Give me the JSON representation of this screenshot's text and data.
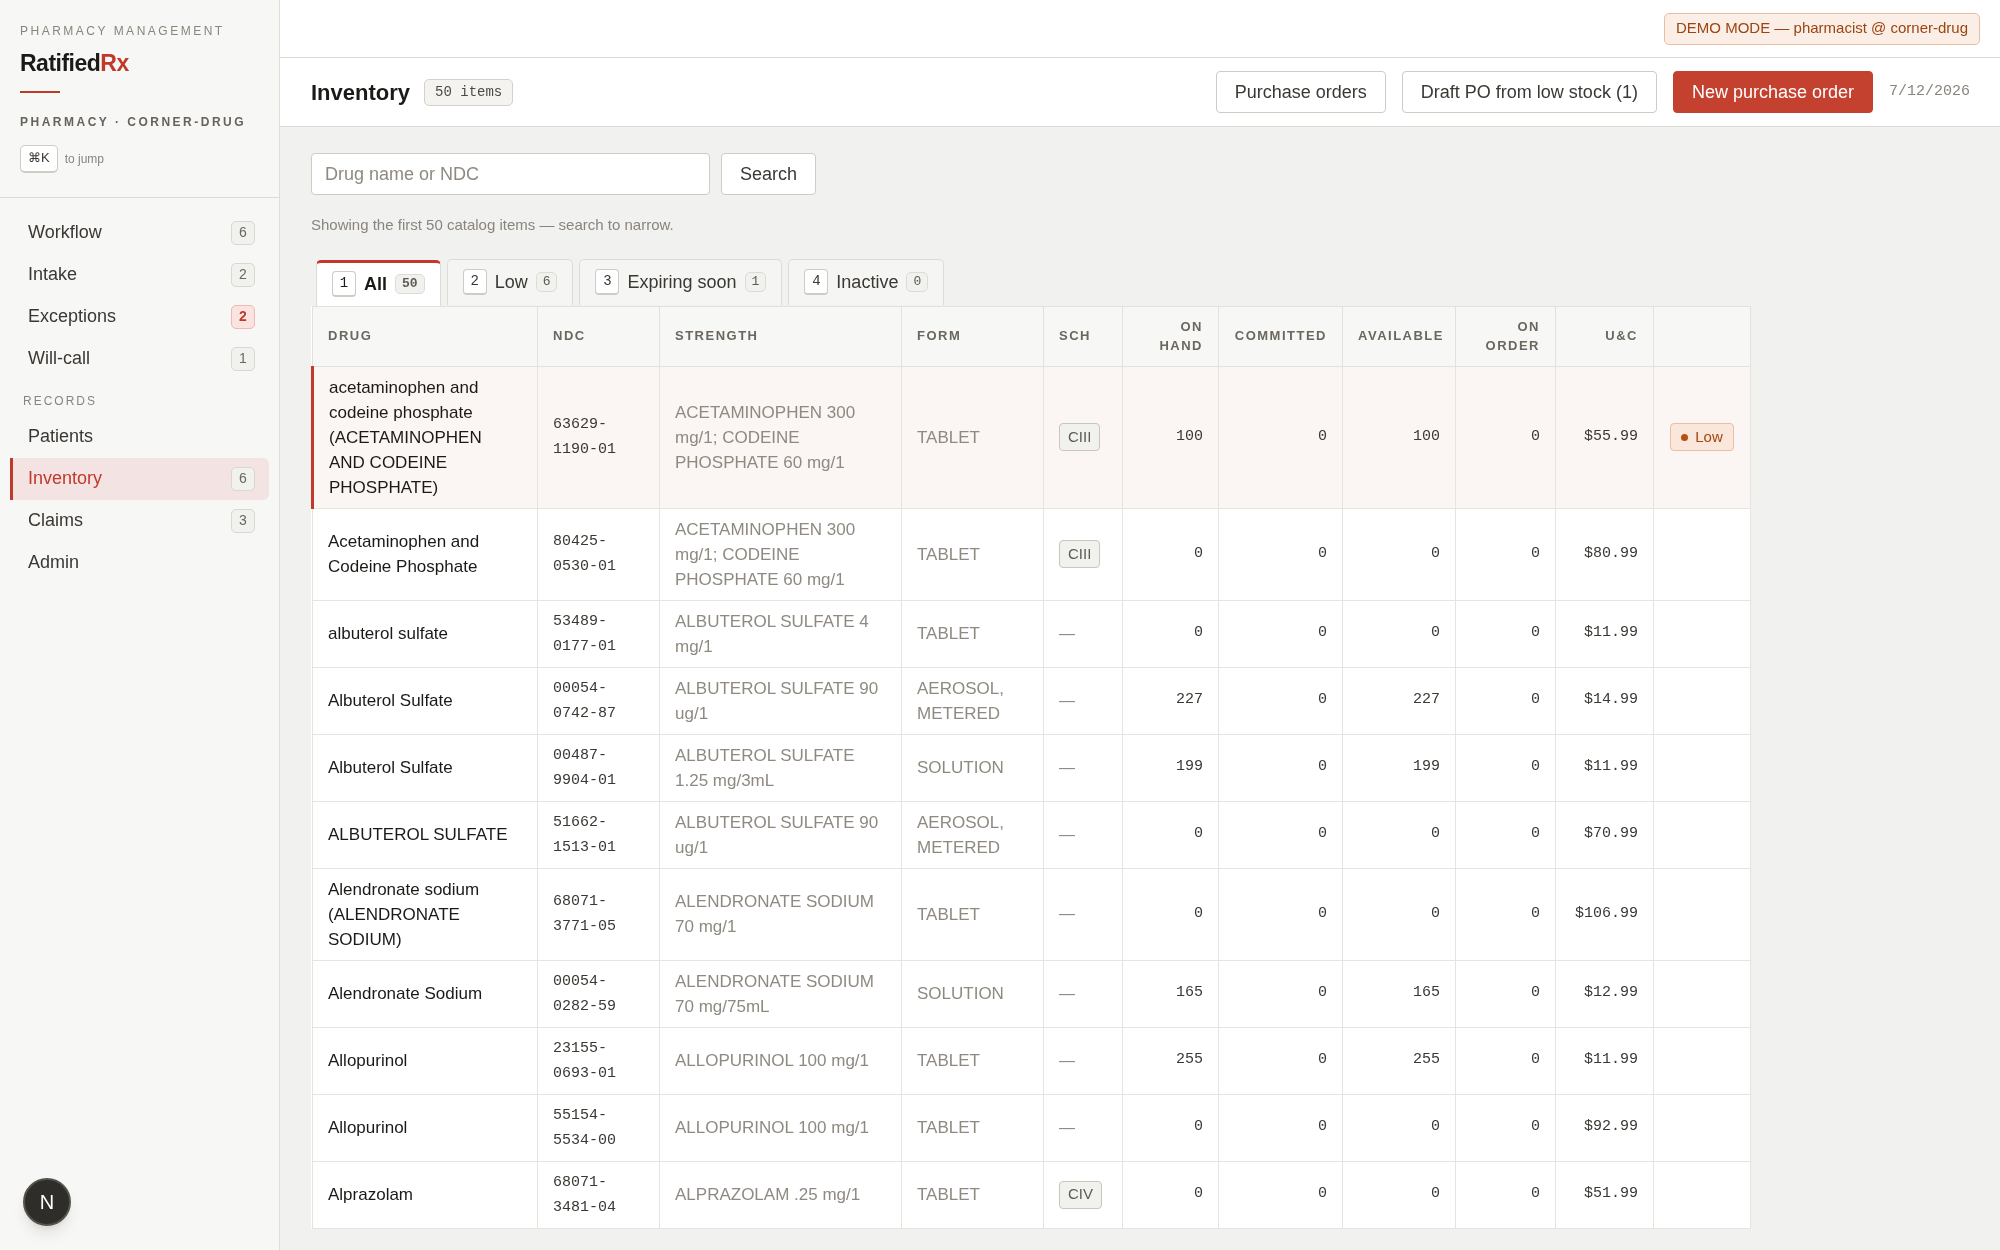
{
  "sidebar": {
    "eyebrow": "PHARMACY MANAGEMENT",
    "logo": {
      "name": "Ratified",
      "accent": "Rx"
    },
    "pharmacy": "PHARMACY · CORNER-DRUG",
    "shortcut": {
      "key": "⌘K",
      "hint": "to jump"
    },
    "items": [
      {
        "label": "Workflow",
        "count": "6",
        "alert": false,
        "selected": false
      },
      {
        "label": "Intake",
        "count": "2",
        "alert": false,
        "selected": false
      },
      {
        "label": "Exceptions",
        "count": "2",
        "alert": true,
        "selected": false
      },
      {
        "label": "Will-call",
        "count": "1",
        "alert": false,
        "selected": false
      }
    ],
    "section_label": "RECORDS",
    "records": [
      {
        "label": "Patients",
        "selected": false
      },
      {
        "label": "Inventory",
        "count": "6",
        "alert": false,
        "selected": true
      },
      {
        "label": "Claims",
        "count": "3",
        "alert": false,
        "selected": false
      },
      {
        "label": "Admin",
        "selected": false
      }
    ]
  },
  "user_avatar": "N",
  "demo_banner": "DEMO MODE — pharmacist @ corner-drug",
  "page": {
    "title": "Inventory",
    "count": "50 items",
    "buttons": [
      {
        "label": "Purchase orders",
        "kind": "secondary"
      },
      {
        "label": "Draft PO from low stock (1)",
        "kind": "secondary"
      },
      {
        "label": "New purchase order",
        "kind": "primary"
      }
    ],
    "date": "7/12/2026"
  },
  "search": {
    "placeholder": "Drug name or NDC",
    "button": "Search"
  },
  "hint": "Showing the first 50 catalog items — search to narrow.",
  "tabs": [
    {
      "key": "1",
      "label": "All",
      "count": "50",
      "selected": true
    },
    {
      "key": "2",
      "label": "Low",
      "count": "6",
      "selected": false
    },
    {
      "key": "3",
      "label": "Expiring soon",
      "count": "1",
      "selected": false
    },
    {
      "key": "4",
      "label": "Inactive",
      "count": "0",
      "selected": false
    }
  ],
  "table": {
    "columns": [
      "DRUG",
      "NDC",
      "STRENGTH",
      "FORM",
      "SCH",
      "ON HAND",
      "COMMITTED",
      "AVAILABLE",
      "ON ORDER",
      "U&C"
    ],
    "rows": [
      {
        "drug": "acetaminophen and codeine phosphate (ACETAMINOPHEN AND CODEINE PHOSPHATE)",
        "ndc": "63629-1190-01",
        "strength": "ACETAMINOPHEN 300 mg/1; CODEINE PHOSPHATE 60 mg/1",
        "form": "TABLET",
        "sch": "CIII",
        "controlled": true,
        "on_hand": "100",
        "committed": "0",
        "available": "100",
        "on_order": "0",
        "price": "$55.99",
        "flagged": true,
        "status": "Low"
      },
      {
        "drug": "Acetaminophen and Codeine Phosphate",
        "ndc": "80425-0530-01",
        "strength": "ACETAMINOPHEN 300 mg/1; CODEINE PHOSPHATE 60 mg/1",
        "form": "TABLET",
        "sch": "CIII",
        "controlled": true,
        "on_hand": "0",
        "committed": "0",
        "available": "0",
        "on_order": "0",
        "price": "$80.99",
        "flagged": false
      },
      {
        "drug": "albuterol sulfate",
        "ndc": "53489-0177-01",
        "strength": "ALBUTEROL SULFATE 4 mg/1",
        "form": "TABLET",
        "sch": "—",
        "controlled": false,
        "on_hand": "0",
        "committed": "0",
        "available": "0",
        "on_order": "0",
        "price": "$11.99",
        "flagged": false
      },
      {
        "drug": "Albuterol Sulfate",
        "ndc": "00054-0742-87",
        "strength": "ALBUTEROL SULFATE 90 ug/1",
        "form": "AEROSOL, METERED",
        "sch": "—",
        "controlled": false,
        "on_hand": "227",
        "committed": "0",
        "available": "227",
        "on_order": "0",
        "price": "$14.99",
        "flagged": false
      },
      {
        "drug": "Albuterol Sulfate",
        "ndc": "00487-9904-01",
        "strength": "ALBUTEROL SULFATE 1.25 mg/3mL",
        "form": "SOLUTION",
        "sch": "—",
        "controlled": false,
        "on_hand": "199",
        "committed": "0",
        "available": "199",
        "on_order": "0",
        "price": "$11.99",
        "flagged": false
      },
      {
        "drug": "ALBUTEROL SULFATE",
        "ndc": "51662-1513-01",
        "strength": "ALBUTEROL SULFATE 90 ug/1",
        "form": "AEROSOL, METERED",
        "sch": "—",
        "controlled": false,
        "on_hand": "0",
        "committed": "0",
        "available": "0",
        "on_order": "0",
        "price": "$70.99",
        "flagged": false
      },
      {
        "drug": "Alendronate sodium (ALENDRONATE SODIUM)",
        "ndc": "68071-3771-05",
        "strength": "ALENDRONATE SODIUM 70 mg/1",
        "form": "TABLET",
        "sch": "—",
        "controlled": false,
        "on_hand": "0",
        "committed": "0",
        "available": "0",
        "on_order": "0",
        "price": "$106.99",
        "flagged": false
      },
      {
        "drug": "Alendronate Sodium",
        "ndc": "00054-0282-59",
        "strength": "ALENDRONATE SODIUM 70 mg/75mL",
        "form": "SOLUTION",
        "sch": "—",
        "controlled": false,
        "on_hand": "165",
        "committed": "0",
        "available": "165",
        "on_order": "0",
        "price": "$12.99",
        "flagged": false
      },
      {
        "drug": "Allopurinol",
        "ndc": "23155-0693-01",
        "strength": "ALLOPURINOL 100 mg/1",
        "form": "TABLET",
        "sch": "—",
        "controlled": false,
        "on_hand": "255",
        "committed": "0",
        "available": "255",
        "on_order": "0",
        "price": "$11.99",
        "flagged": false
      },
      {
        "drug": "Allopurinol",
        "ndc": "55154-5534-00",
        "strength": "ALLOPURINOL 100 mg/1",
        "form": "TABLET",
        "sch": "—",
        "controlled": false,
        "on_hand": "0",
        "committed": "0",
        "available": "0",
        "on_order": "0",
        "price": "$92.99",
        "flagged": false
      },
      {
        "drug": "Alprazolam",
        "ndc": "68071-3481-04",
        "strength": "ALPRAZOLAM .25 mg/1",
        "form": "TABLET",
        "sch": "CIV",
        "controlled": true,
        "on_hand": "0",
        "committed": "0",
        "available": "0",
        "on_order": "0",
        "price": "$51.99",
        "flagged": false
      }
    ]
  }
}
